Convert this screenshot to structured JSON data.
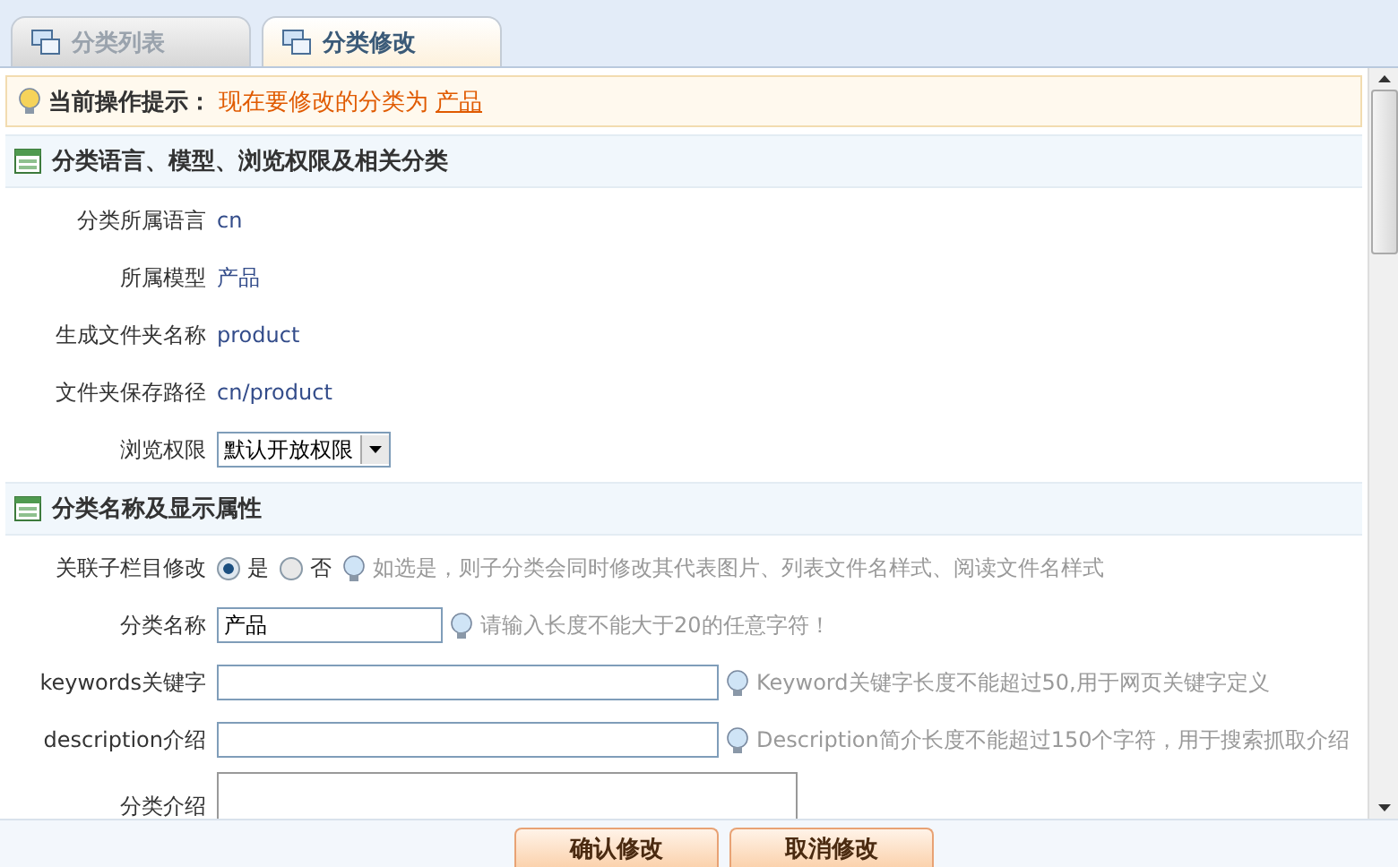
{
  "tabs": [
    {
      "label": "分类列表",
      "selected": false
    },
    {
      "label": "分类修改",
      "selected": true
    }
  ],
  "notice": {
    "label": "当前操作提示：",
    "text": "现在要修改的分类为 ",
    "link": "产品"
  },
  "sections": [
    {
      "title": "分类语言、模型、浏览权限及相关分类",
      "rows": [
        {
          "kind": "text",
          "label": "分类所属语言",
          "value": "cn"
        },
        {
          "kind": "text",
          "label": "所属模型",
          "value": "产品"
        },
        {
          "kind": "text",
          "label": "生成文件夹名称",
          "value": "product"
        },
        {
          "kind": "text",
          "label": "文件夹保存路径",
          "value": "cn/product"
        },
        {
          "kind": "select",
          "label": "浏览权限",
          "value": "默认开放权限"
        }
      ]
    },
    {
      "title": "分类名称及显示属性",
      "rows": [
        {
          "kind": "radio",
          "label": "关联子栏目修改",
          "options": [
            {
              "label": "是",
              "selected": true
            },
            {
              "label": "否",
              "selected": false
            }
          ],
          "hint": "如选是，则子分类会同时修改其代表图片、列表文件名样式、阅读文件名样式"
        },
        {
          "kind": "input",
          "label": "分类名称",
          "value": "产品",
          "hint": "请输入长度不能大于20的任意字符！"
        },
        {
          "kind": "wideinput",
          "label": "keywords关键字",
          "value": "",
          "hint": "Keyword关键字长度不能超过50,用于网页关键字定义"
        },
        {
          "kind": "wideinput",
          "label": "description介绍",
          "value": "",
          "hint": "Description简介长度不能超过150个字符，用于搜索抓取介绍"
        },
        {
          "kind": "textarea",
          "label": "分类介绍",
          "value": ""
        }
      ]
    }
  ],
  "buttons": [
    "确认修改",
    "取消修改"
  ]
}
